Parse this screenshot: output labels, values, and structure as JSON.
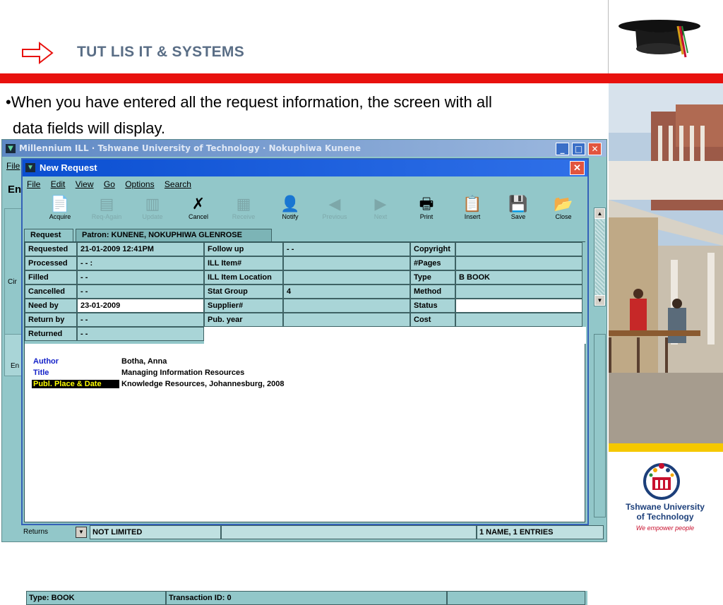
{
  "slide": {
    "title": "TUT LIS IT & SYSTEMS",
    "bullet": "•When you have entered all the request information, the screen with all",
    "bullet_line2": "data fields will display.",
    "university_name_1": "Tshwane University",
    "university_name_2": "of Technology",
    "tagline": "We empower people",
    "colors": {
      "accent_red": "#e8110e",
      "title_color": "#5a6e86",
      "uni_blue": "#1c3f7a",
      "yellow": "#f5c800"
    }
  },
  "outer_window": {
    "title": "Millennium ILL · Tshwane University of Technology · Nokuphiwa Kunene",
    "menu_fragment": "File",
    "heading_fragment": "En",
    "side_label_1": "Cir",
    "side_label_2": "En",
    "status": {
      "dropdown_value": "Returns",
      "limit": "NOT LIMITED",
      "entries": "1 NAME, 1 ENTRIES"
    }
  },
  "inner_window": {
    "title": "New Request",
    "menu": [
      "File",
      "Edit",
      "View",
      "Go",
      "Options",
      "Search"
    ],
    "toolbar": [
      {
        "label": "Acquire",
        "icon": "acquire-icon",
        "enabled": true
      },
      {
        "label": "Req-Again",
        "icon": "req-again-icon",
        "enabled": false
      },
      {
        "label": "Update",
        "icon": "update-icon",
        "enabled": false
      },
      {
        "label": "Cancel",
        "icon": "cancel-icon",
        "enabled": true
      },
      {
        "label": "Receive",
        "icon": "receive-icon",
        "enabled": false
      },
      {
        "label": "Notify",
        "icon": "notify-icon",
        "enabled": true
      },
      {
        "label": "Previous",
        "icon": "previous-icon",
        "enabled": false
      },
      {
        "label": "Next",
        "icon": "next-icon",
        "enabled": false
      },
      {
        "label": "Print",
        "icon": "print-icon",
        "enabled": true
      },
      {
        "label": "Insert",
        "icon": "insert-icon",
        "enabled": true
      },
      {
        "label": "Save",
        "icon": "save-icon",
        "enabled": true
      },
      {
        "label": "Close",
        "icon": "close-icon",
        "enabled": true
      }
    ],
    "tabs": {
      "request": "Request",
      "patron": "Patron:  KUNENE, NOKUPHIWA GLENROSE"
    },
    "fields_col1": [
      {
        "label": "Requested",
        "value": "21-01-2009 12:41PM"
      },
      {
        "label": "Processed",
        "value": " - -      :"
      },
      {
        "label": "Filled",
        "value": " - -"
      },
      {
        "label": "Cancelled",
        "value": " - -"
      },
      {
        "label": "Need by",
        "value": "23-01-2009"
      },
      {
        "label": "Return by",
        "value": " - -"
      },
      {
        "label": "Returned",
        "value": " - -"
      }
    ],
    "fields_col2": [
      {
        "label": "Follow up",
        "value": " - -"
      },
      {
        "label": "ILL Item#",
        "value": ""
      },
      {
        "label": "ILL Item Location",
        "value": ""
      },
      {
        "label": "Stat Group",
        "value": "4"
      },
      {
        "label": "Supplier#",
        "value": ""
      },
      {
        "label": "Pub. year",
        "value": ""
      }
    ],
    "fields_col3": [
      {
        "label": "Copyright",
        "value": ""
      },
      {
        "label": "#Pages",
        "value": ""
      },
      {
        "label": "Type",
        "value": "B   BOOK"
      },
      {
        "label": "Method",
        "value": ""
      },
      {
        "label": "Status",
        "value": ""
      },
      {
        "label": "Cost",
        "value": ""
      }
    ],
    "biblio": [
      {
        "label": "Author",
        "value": "Botha, Anna"
      },
      {
        "label": "Title",
        "value": "Managing Information Resources"
      },
      {
        "label": "Publ. Place & Date",
        "value": "Knowledge Resources, Johannesburg, 2008"
      }
    ],
    "status": {
      "type": "Type:  BOOK",
      "transaction": "Transaction ID:  0"
    }
  }
}
